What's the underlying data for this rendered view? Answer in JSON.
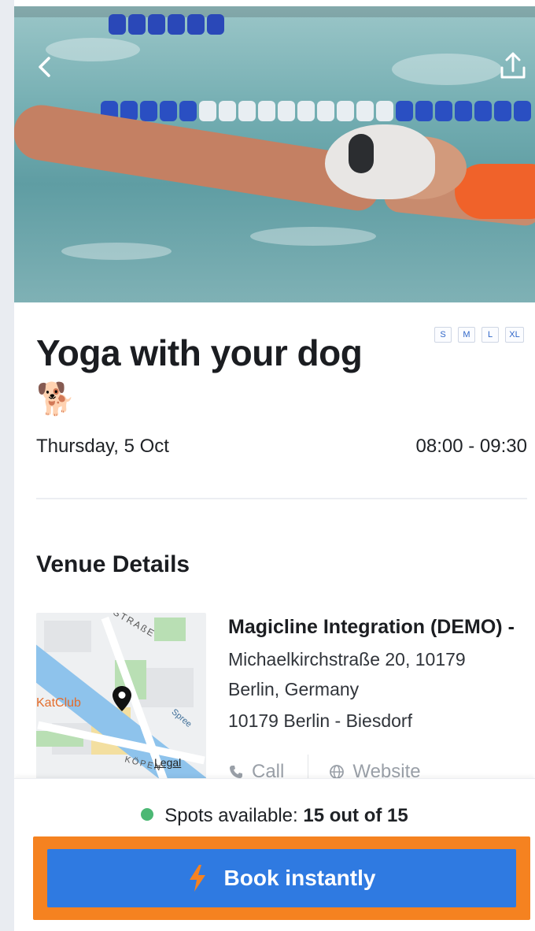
{
  "header": {
    "back_icon": "chevron-left-icon",
    "share_icon": "share-upload-icon"
  },
  "event": {
    "title": "Yoga with your dog",
    "title_emoji": "🐕",
    "size_tags": [
      "S",
      "M",
      "L",
      "XL"
    ],
    "date": "Thursday, 5 Oct",
    "time": "08:00 - 09:30"
  },
  "venue": {
    "heading": "Venue Details",
    "name": "Magicline Integration (DEMO) -",
    "address_line1": "Michaelkirchstraße 20, 10179",
    "address_line2": "Berlin, Germany",
    "address_line3": "10179 Berlin - Biesdorf",
    "call_label": "Call",
    "website_label": "Website",
    "map": {
      "club_label": "KatClub",
      "street_label_1": "STRAßE",
      "street_label_2": "KÖPEN",
      "river_label": "Spree",
      "legal_label": "Legal"
    }
  },
  "booking": {
    "spots_prefix": "Spots available:",
    "spots_count": "15 out of 15",
    "book_label": "Book instantly",
    "accent_orange": "#f58220",
    "button_blue": "#2f7ae1",
    "available_green": "#4cb874"
  }
}
